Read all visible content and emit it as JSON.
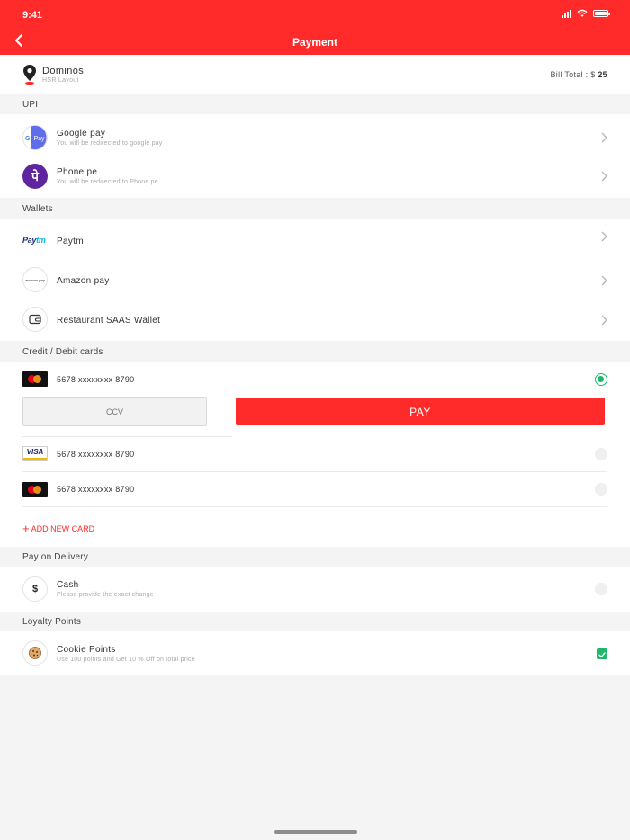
{
  "status_bar": {
    "time": "9:41"
  },
  "header": {
    "title": "Payment"
  },
  "restaurant": {
    "name": "Dominos",
    "location": "HSR Layout",
    "bill_label": "Bill Total : $",
    "bill_amount": "25"
  },
  "sections": {
    "upi": "UPI",
    "wallets": "Wallets",
    "cards": "Credit / Debit cards",
    "pod": "Pay on Delivery",
    "loyalty": "Loyalty Points"
  },
  "upi": [
    {
      "name": "Google pay",
      "sub": "You will be redirected to google pay",
      "icon": "google-pay-icon",
      "icon_text": "Pay"
    },
    {
      "name": "Phone pe",
      "sub": "You will be redirected to Phone pe",
      "icon": "phonepe-icon",
      "icon_text": "पे"
    }
  ],
  "wallets": [
    {
      "name": "Paytm",
      "icon": "paytm-logo",
      "icon_text_a": "Pay",
      "icon_text_b": "tm"
    },
    {
      "name": "Amazon pay",
      "icon": "amazon-pay-icon",
      "icon_text": "amazon pay"
    },
    {
      "name": "Restaurant SAAS Wallet",
      "icon": "wallet-icon"
    }
  ],
  "cards": [
    {
      "number": "5678 xxxxxxxx 8790",
      "brand": "mastercard",
      "selected": true
    },
    {
      "number": "5678 xxxxxxxx 8790",
      "brand": "visa",
      "brand_text": "VISA",
      "selected": false
    },
    {
      "number": "5678 xxxxxxxx 8790",
      "brand": "mastercard",
      "selected": false
    }
  ],
  "ccv_placeholder": "CCV",
  "pay_label": "PAY",
  "add_card_label": "ADD NEW CARD",
  "cash": {
    "name": "Cash",
    "sub": "Please provide the exact change",
    "icon_text": "$"
  },
  "loyalty": {
    "name": "Cookie Points",
    "sub": "Use 100 points and Get 10 % Off on total price",
    "checked": true
  },
  "colors": {
    "brand": "#ff2a2a",
    "success": "#1fb86a"
  }
}
